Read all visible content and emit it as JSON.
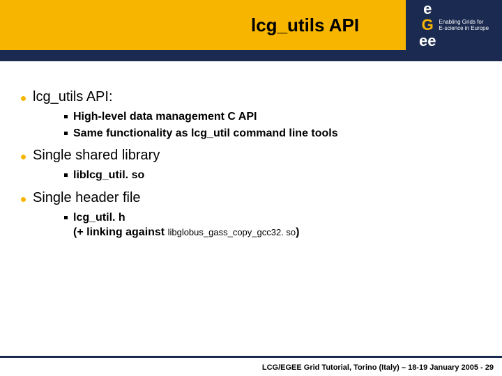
{
  "header": {
    "title": "lcg_utils API",
    "logo": {
      "line1": "Enabling Grids for",
      "line2": "E-science in Europe"
    }
  },
  "bullets": [
    {
      "text": "lcg_utils API:",
      "subs": [
        {
          "text": "High-level data management C API"
        },
        {
          "text": "Same functionality as lcg_util command line tools"
        }
      ]
    },
    {
      "text": "Single shared library",
      "subs": [
        {
          "text": "liblcg_util. so"
        }
      ]
    },
    {
      "text": "Single header file",
      "subs": [
        {
          "text": "lcg_util. h",
          "text2_prefix": "(+ linking against ",
          "text2_small": "libglobus_gass_copy_gcc32. so",
          "text2_suffix": ")"
        }
      ]
    }
  ],
  "footer": "LCG/EGEE Grid Tutorial, Torino (Italy) – 18-19 January 2005 - 29"
}
